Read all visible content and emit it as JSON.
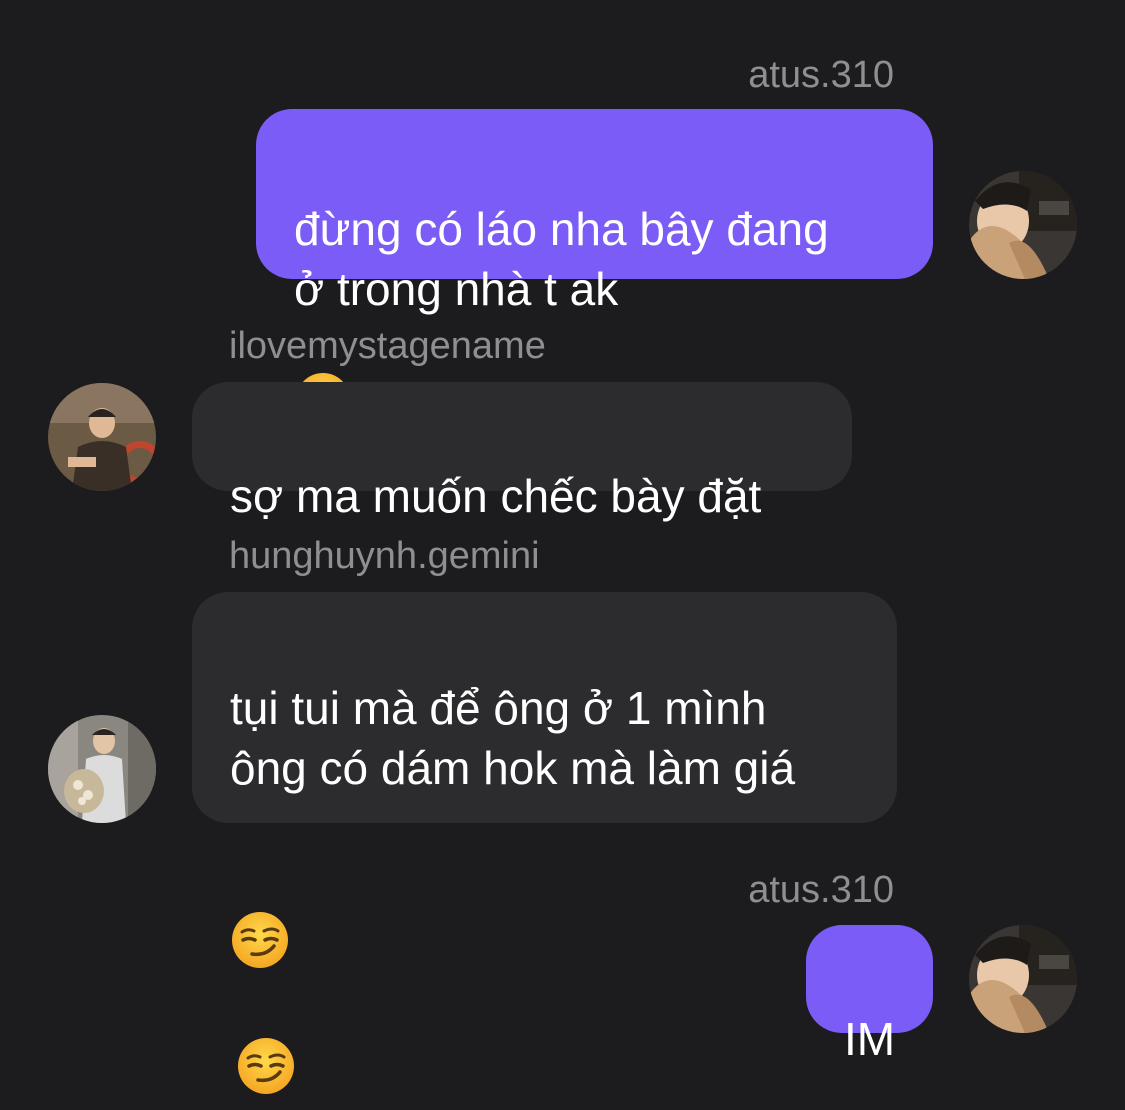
{
  "messages": [
    {
      "sender": "atus.310",
      "direction": "outgoing",
      "text": "đừng có láo nha bây đang\nở trong nhà t ak",
      "emoji": [
        "angry-face-icon"
      ]
    },
    {
      "sender": "ilovemystagename",
      "direction": "incoming",
      "text": "sợ ma muốn chếc bày đặt",
      "emoji": []
    },
    {
      "sender": "hunghuynh.gemini",
      "direction": "incoming",
      "text": "tụi tui mà để ông ở 1 mình\nông có dám hok mà làm giá",
      "emoji": [
        "smirking-face-icon",
        "smirking-face-icon"
      ]
    },
    {
      "sender": "atus.310",
      "direction": "outgoing",
      "text": "IM",
      "emoji": []
    }
  ],
  "colors": {
    "background": "#1c1c1e",
    "outgoing_bubble": "#7b5cf6",
    "incoming_bubble": "#2c2c2e",
    "sender_name": "#8e8e93",
    "message_text": "#ffffff"
  }
}
